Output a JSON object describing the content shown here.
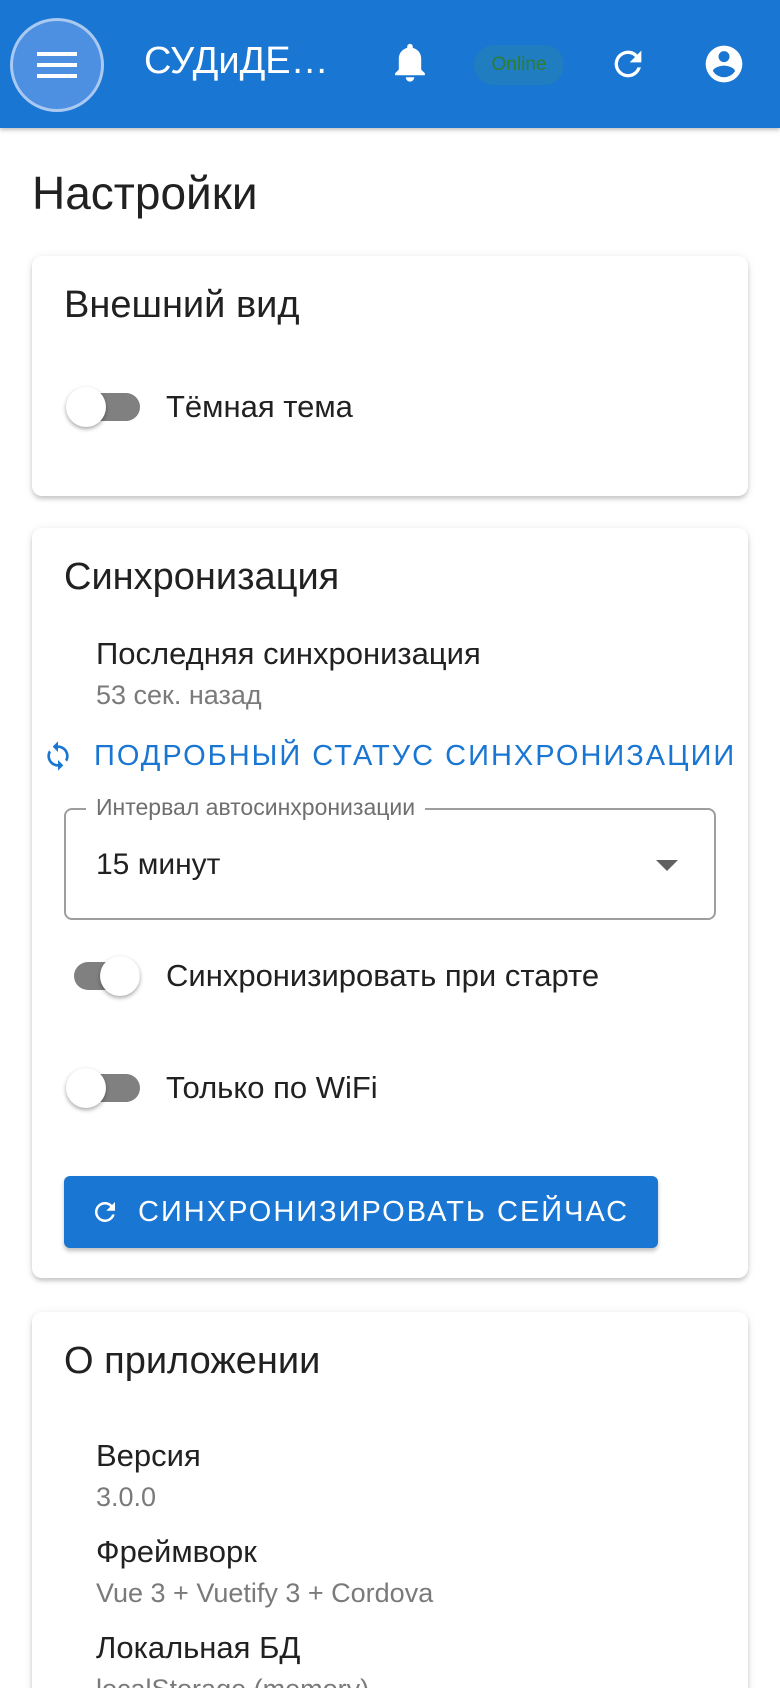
{
  "appbar": {
    "title": "СУДиДЕ…",
    "status_chip": "Online",
    "icons": [
      "menu-icon",
      "bell-icon",
      "refresh-icon",
      "account-circle-icon"
    ]
  },
  "page": {
    "title": "Настройки"
  },
  "appearance": {
    "title": "Внешний вид",
    "dark_theme_label": "Тёмная тема",
    "dark_theme_enabled": false
  },
  "sync": {
    "title": "Синхронизация",
    "last_sync_label": "Последняя синхронизация",
    "last_sync_value": "53 сек. назад",
    "status_button": "ПОДРОБНЫЙ СТАТУС СИНХРОНИЗАЦИИ",
    "interval_label": "Интервал автосинхронизации",
    "interval_value": "15 минут",
    "on_start_label": "Синхронизировать при старте",
    "on_start_enabled": true,
    "wifi_only_label": "Только по WiFi",
    "wifi_only_enabled": false,
    "sync_now_button": "СИНХРОНИЗИРОВАТЬ СЕЙЧАС"
  },
  "about": {
    "title": "О приложении",
    "items": [
      {
        "label": "Версия",
        "value": "3.0.0"
      },
      {
        "label": "Фреймворк",
        "value": "Vue 3 + Vuetify 3 + Cordova"
      },
      {
        "label": "Локальная БД",
        "value": "localStorage (memory)"
      }
    ]
  },
  "colors": {
    "primary": "#1976d2",
    "online_text": "#2e7d32",
    "switch_track": "#808080"
  }
}
